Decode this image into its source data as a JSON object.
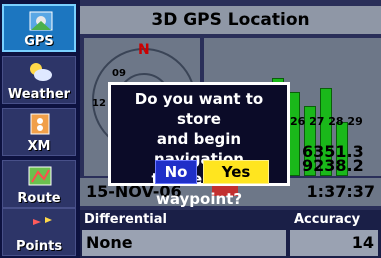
{
  "sidebar": {
    "tabs": [
      {
        "label": "GPS",
        "icon": "satellite-icon",
        "active": true
      },
      {
        "label": "Weather",
        "icon": "weather-icon",
        "active": false
      },
      {
        "label": "XM",
        "icon": "xm-radio-icon",
        "active": false
      },
      {
        "label": "Route",
        "icon": "route-icon",
        "active": false
      },
      {
        "label": "Points",
        "icon": "points-icon",
        "active": false
      }
    ]
  },
  "main": {
    "title": "3D GPS Location",
    "sky": {
      "north_label": "N",
      "sat_labels": [
        "09",
        "12"
      ]
    },
    "bar_labels": "26 27 28 29",
    "coords": {
      "lat": "6351.3",
      "lon": "9238.2"
    },
    "date": "15-NOV-06",
    "time": "1:37:37",
    "labels": {
      "differential": "Differential",
      "accuracy": "Accuracy"
    },
    "values": {
      "differential": "None",
      "accuracy": "14"
    }
  },
  "dialog": {
    "line1": "Do you want to store",
    "line2": "and begin navigation",
    "line3": "to the MOB waypoint?",
    "no_label": "No",
    "yes_label": "Yes"
  },
  "colors": {
    "accent": "#1c76c0",
    "yes": "#ffe51f",
    "no": "#1f2fc8",
    "bars": "#1ab81a"
  }
}
